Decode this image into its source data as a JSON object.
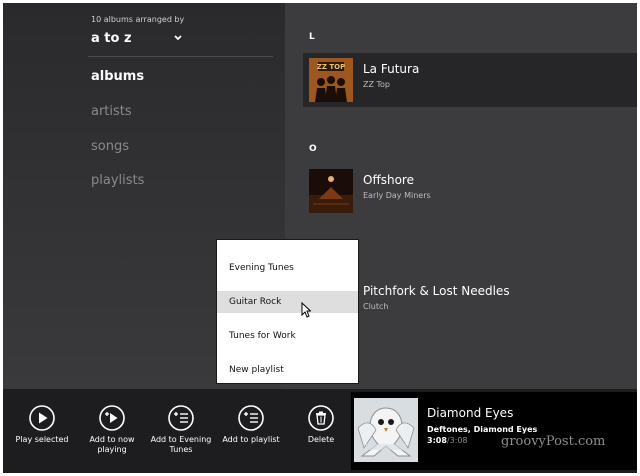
{
  "sidebar": {
    "arranged_caption": "10 albums arranged by",
    "sort_value": "a to z",
    "nav": [
      {
        "label": "albums"
      },
      {
        "label": "artists"
      },
      {
        "label": "songs"
      },
      {
        "label": "playlists"
      }
    ]
  },
  "albums": {
    "groups": [
      {
        "letter": "L"
      },
      {
        "letter": "O"
      }
    ],
    "items": [
      {
        "title": "La Futura",
        "artist": "ZZ Top"
      },
      {
        "title": "Offshore",
        "artist": "Early Day Miners"
      },
      {
        "title": "Pitchfork & Lost Needles",
        "artist": "Clutch"
      }
    ]
  },
  "playlist_menu": {
    "items": [
      {
        "label": "Evening Tunes"
      },
      {
        "label": "Guitar Rock"
      },
      {
        "label": "Tunes for Work"
      },
      {
        "label": "New playlist"
      }
    ]
  },
  "appbar": {
    "buttons": [
      {
        "label": "Play selected",
        "icon": "play-icon"
      },
      {
        "label": "Add to now playing",
        "icon": "add-to-now-playing-icon"
      },
      {
        "label": "Add to Evening Tunes",
        "icon": "add-list-icon"
      },
      {
        "label": "Add to playlist",
        "icon": "add-list-icon"
      },
      {
        "label": "Delete",
        "icon": "trash-icon"
      }
    ]
  },
  "now_playing": {
    "title": "Diamond Eyes",
    "artist": "Deftones, Diamond Eyes",
    "elapsed": "3:08",
    "total": "/3:08"
  },
  "watermark": "groovyPost.com",
  "colors": {
    "background": "#2b2b2d",
    "panel": "#3c3c3e",
    "selected_row": "#262628",
    "appbar": "#1d1d1f",
    "menu_hover": "#dedede"
  }
}
